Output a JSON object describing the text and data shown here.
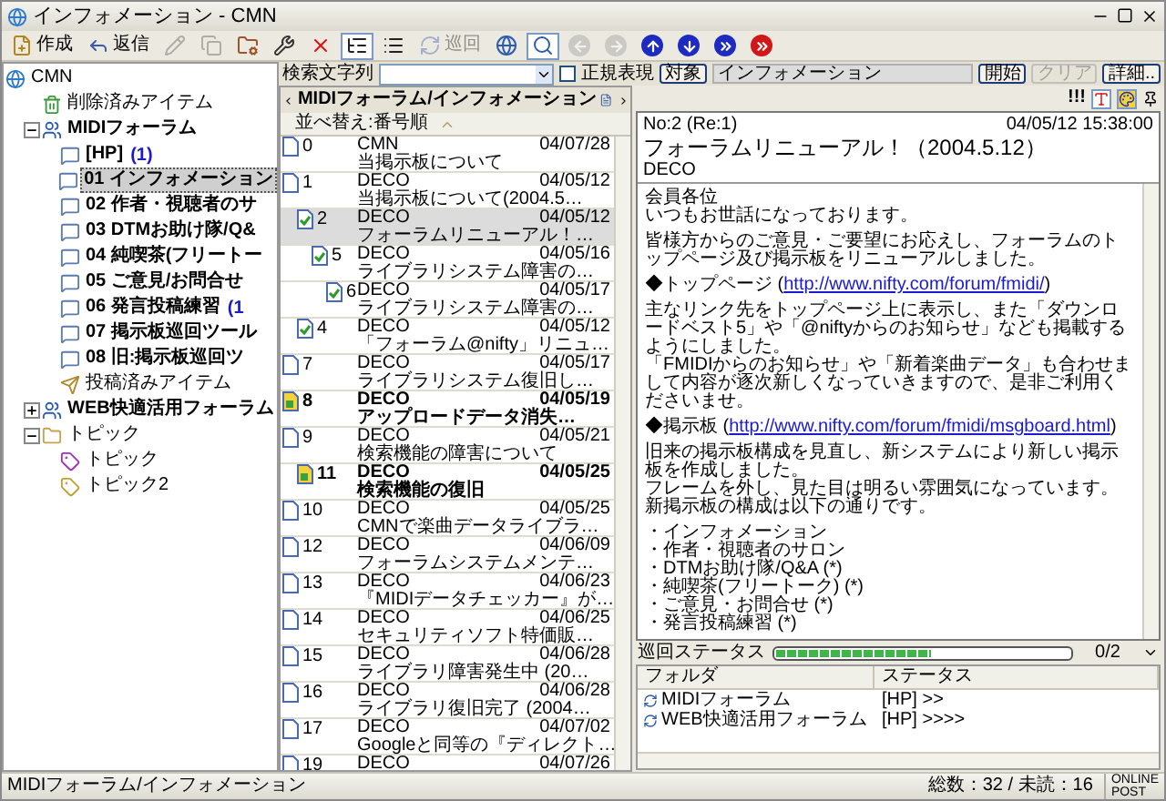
{
  "window": {
    "title": "インフォメーション - CMN"
  },
  "toolbar": [
    {
      "kind": "new",
      "label": "作成",
      "disabled": false,
      "selected": false
    },
    {
      "kind": "reply",
      "label": "返信",
      "disabled": false,
      "selected": false
    },
    {
      "kind": "edit",
      "disabled": true,
      "selected": false
    },
    {
      "kind": "copy",
      "disabled": true,
      "selected": false
    },
    {
      "kind": "properties",
      "disabled": false,
      "selected": false
    },
    {
      "kind": "tools",
      "disabled": false,
      "selected": false
    },
    {
      "kind": "delete",
      "disabled": false,
      "selected": false
    },
    {
      "kind": "tree",
      "disabled": false,
      "selected": true
    },
    {
      "kind": "list",
      "disabled": false,
      "selected": false
    },
    {
      "kind": "patrol",
      "label": "巡回",
      "disabled": true,
      "selected": false
    },
    {
      "kind": "sync",
      "disabled": false,
      "selected": false
    },
    {
      "kind": "find",
      "disabled": false,
      "selected": true
    },
    {
      "kind": "back",
      "disabled": true,
      "selected": false
    },
    {
      "kind": "forward",
      "disabled": true,
      "selected": false
    },
    {
      "kind": "up",
      "disabled": false,
      "selected": false
    },
    {
      "kind": "down",
      "disabled": false,
      "selected": false
    },
    {
      "kind": "next",
      "disabled": false,
      "selected": false
    },
    {
      "kind": "stop",
      "disabled": false,
      "selected": false
    }
  ],
  "tree": [
    {
      "kind": "root",
      "label": "CMN",
      "selected": false,
      "children": [
        {
          "kind": "trash",
          "label": "削除済みアイテム",
          "selected": false
        },
        {
          "kind": "forum",
          "label": "MIDIフォーラム",
          "selected": false,
          "expanded": true,
          "children": [
            {
              "kind": "board",
              "label": "[HP]",
              "count": "(1)",
              "selected": false
            },
            {
              "kind": "board",
              "label": "01 インフォメーション",
              "selected": true
            },
            {
              "kind": "board",
              "label": "02 作者・視聴者のサ",
              "selected": false
            },
            {
              "kind": "board",
              "label": "03 DTMお助け隊/Q&",
              "selected": false
            },
            {
              "kind": "board",
              "label": "04 純喫茶(フリートー",
              "selected": false
            },
            {
              "kind": "board",
              "label": "05 ご意見/お問合せ",
              "selected": false
            },
            {
              "kind": "board",
              "label": "06 発言投稿練習",
              "count": "(1",
              "selected": false
            },
            {
              "kind": "board",
              "label": "07 掲示板巡回ツール",
              "selected": false
            },
            {
              "kind": "board",
              "label": "08 旧:掲示板巡回ツ",
              "selected": false
            },
            {
              "kind": "sent",
              "label": "投稿済みアイテム",
              "selected": false
            }
          ]
        },
        {
          "kind": "forum",
          "label": "WEB快適活用フォーラム",
          "selected": false,
          "expanded": false
        },
        {
          "kind": "folder",
          "label": "トピック",
          "selected": false,
          "expanded": true,
          "children": [
            {
              "kind": "topic",
              "label": "トピック",
              "selected": false
            },
            {
              "kind": "topic2",
              "label": "トピック2",
              "selected": false
            }
          ]
        }
      ]
    }
  ],
  "search": {
    "label": "検索文字列",
    "regex": {
      "label": "正規表現",
      "checked": false
    },
    "target_button": "対象",
    "target": "インフォメーション",
    "buttons": [
      {
        "label": "開始",
        "disabled": false
      },
      {
        "label": "クリア",
        "disabled": true
      },
      {
        "label": "詳細..",
        "disabled": false
      }
    ]
  },
  "list": {
    "path": "MIDIフォーラム/インフォメーション",
    "sort": "並べ替え:番号順",
    "messages": [
      {
        "no": "0",
        "author": "CMN",
        "date": "04/07/28",
        "subject": "当掲示板について",
        "unread": false,
        "selected": false
      },
      {
        "no": "1",
        "author": "DECO",
        "date": "04/05/12",
        "subject": "当掲示板について(2004.5…",
        "unread": false,
        "selected": false,
        "children": [
          {
            "no": "2",
            "author": "DECO",
            "date": "04/05/12",
            "subject": "フォーラムリニューアル！…",
            "unread": false,
            "selected": true,
            "children": [
              {
                "no": "5",
                "author": "DECO",
                "date": "04/05/16",
                "subject": "ライブラリシステム障害の…",
                "unread": false,
                "selected": false,
                "children": [
                  {
                    "no": "6",
                    "author": "DECO",
                    "date": "04/05/17",
                    "subject": "ライブラリシステム障害の…",
                    "unread": false,
                    "selected": false
                  }
                ]
              }
            ]
          },
          {
            "no": "4",
            "author": "DECO",
            "date": "04/05/12",
            "subject": "「フォーラム@nifty」リニュ…",
            "unread": false,
            "selected": false
          }
        ]
      },
      {
        "no": "7",
        "author": "DECO",
        "date": "04/05/17",
        "subject": "ライブラリシステム復旧し…",
        "unread": false,
        "selected": false
      },
      {
        "no": "8",
        "author": "DECO",
        "date": "04/05/19",
        "subject": "アップロードデータ消失…",
        "unread": true,
        "selected": false
      },
      {
        "no": "9",
        "author": "DECO",
        "date": "04/05/21",
        "subject": "検索機能の障害について",
        "unread": false,
        "selected": false,
        "children": [
          {
            "no": "11",
            "author": "DECO",
            "date": "04/05/25",
            "subject": "検索機能の復旧",
            "unread": true,
            "selected": false
          }
        ]
      },
      {
        "no": "10",
        "author": "DECO",
        "date": "04/05/25",
        "subject": "CMNで楽曲データライブラ…",
        "unread": false,
        "selected": false
      },
      {
        "no": "12",
        "author": "DECO",
        "date": "04/06/09",
        "subject": "フォーラムシステムメンテ…",
        "unread": false,
        "selected": false
      },
      {
        "no": "13",
        "author": "DECO",
        "date": "04/06/23",
        "subject": "『MIDIデータチェッカー』が…",
        "unread": false,
        "selected": false
      },
      {
        "no": "14",
        "author": "DECO",
        "date": "04/06/25",
        "subject": "セキュリティソフト特価販…",
        "unread": false,
        "selected": false
      },
      {
        "no": "15",
        "author": "DECO",
        "date": "04/06/28",
        "subject": "ライブラリ障害発生中 (20…",
        "unread": false,
        "selected": false
      },
      {
        "no": "16",
        "author": "DECO",
        "date": "04/06/28",
        "subject": "ライブラリ復旧完了 (2004…",
        "unread": false,
        "selected": false
      },
      {
        "no": "17",
        "author": "DECO",
        "date": "04/07/02",
        "subject": "Googleと同等の『ディレクト…",
        "unread": false,
        "selected": false
      },
      {
        "no": "19",
        "author": "DECO",
        "date": "04/07/26",
        "unread": false,
        "selected": false
      }
    ]
  },
  "viewer": {
    "priority": "!!!",
    "number": "No:2 (Re:1)",
    "datetime": "04/05/12 15:38:00",
    "title": "フォーラムリニューアル！（2004.5.12）",
    "author": "DECO",
    "body": [
      {
        "kind": "para",
        "lines": [
          "会員各位",
          "いつもお世話になっております。"
        ]
      },
      {
        "kind": "para",
        "lines": [
          "皆様方からのご意見・ご要望にお応えし、フォーラムのトップページ及び掲示板をリニューアルしました。"
        ]
      },
      {
        "kind": "link",
        "prefix": "◆トップページ (",
        "link": "http://www.nifty.com/forum/fmidi/",
        "suffix": ")"
      },
      {
        "kind": "para",
        "lines": [
          "主なリンク先をトップページ上に表示し、また「ダウンロードベスト5」や「@niftyからのお知らせ」なども掲載するようにしました。",
          "「FMIDIからのお知らせ」や「新着楽曲データ」も合わせまして内容が逐次新しくなっていきますので、是非ご利用くださいませ。"
        ]
      },
      {
        "kind": "link",
        "prefix": "◆掲示板 (",
        "link": "http://www.nifty.com/forum/fmidi/msgboard.html",
        "suffix": ")"
      },
      {
        "kind": "para",
        "lines": [
          "旧来の掲示板構成を見直し、新システムにより新しい掲示板を作成しました。",
          "フレームを外し、見た目は明るい雰囲気になっています。",
          "新掲示板の構成は以下の通りです。"
        ]
      },
      {
        "kind": "para",
        "lines": [
          "・インフォメーション",
          "・作者・視聴者のサロン",
          "・DTMお助け隊/Q&A (*)",
          "・純喫茶(フリートーク) (*)",
          "・ご意見・お問合せ (*)",
          "・発言投稿練習 (*)"
        ]
      }
    ]
  },
  "patrol": {
    "label": "巡回ステータス",
    "level": 0.53,
    "count": "0/2",
    "columns": [
      "フォルダ",
      "ステータス"
    ],
    "rows": [
      {
        "folder": "MIDIフォーラム",
        "status": "[HP] >>"
      },
      {
        "folder": "WEB快適活用フォーラム",
        "status": "[HP] >>>>"
      }
    ]
  },
  "status_bar": {
    "path": "MIDIフォーラム/インフォメーション",
    "totals": "総数：32 / 未読：16",
    "mode": [
      "ONLINE",
      "POST"
    ]
  }
}
